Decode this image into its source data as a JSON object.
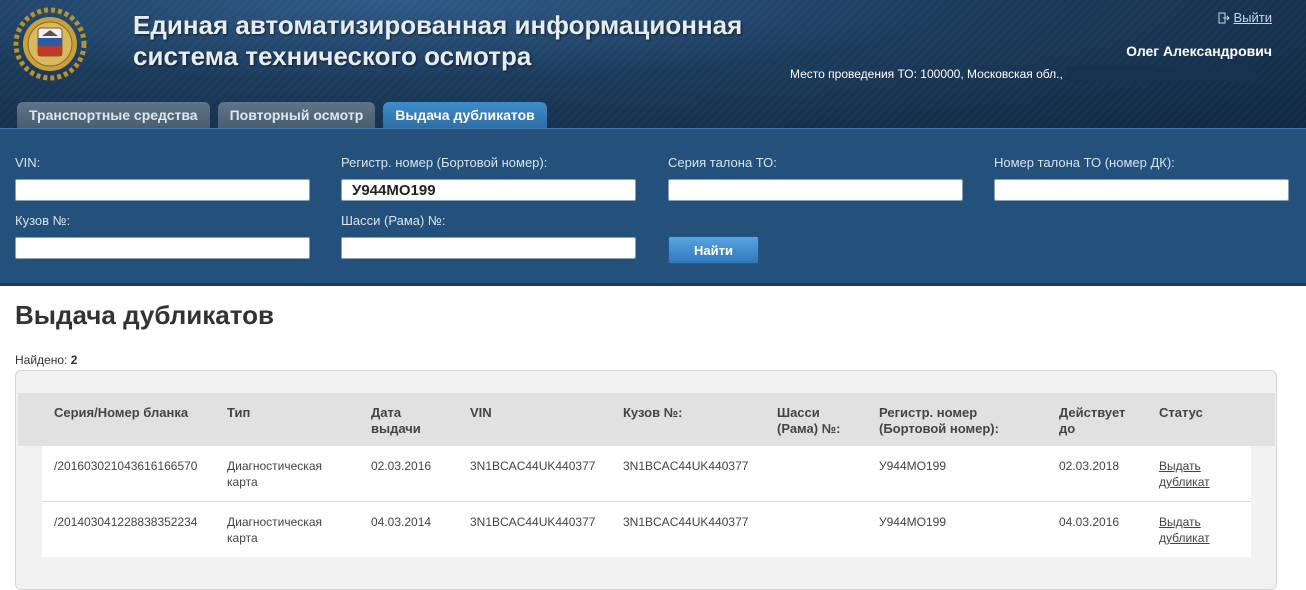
{
  "header": {
    "title_line1": "Единая автоматизированная информационная",
    "title_line2": "система технического осмотра",
    "logout_label": "Выйти",
    "user_name": "Олег Александрович",
    "place_text": "Место проведения ТО: 100000, Московская обл.,",
    "colors": {
      "header_bg": "#1c3b5c",
      "search_bg": "#24507c",
      "active_tab": "#3a86c6"
    }
  },
  "tabs": [
    {
      "label": "Транспортные средства",
      "active": false
    },
    {
      "label": "Повторный осмотр",
      "active": false
    },
    {
      "label": "Выдача дубликатов",
      "active": true
    }
  ],
  "search": {
    "vin_label": "VIN:",
    "vin_value": "",
    "reg_label": "Регистр. номер (Бортовой номер):",
    "reg_value": "У944МО199",
    "series_label": "Серия талона ТО:",
    "series_value": "",
    "ticket_label": "Номер талона ТО (номер ДК):",
    "ticket_value": "",
    "body_label": "Кузов №:",
    "body_value": "",
    "chassis_label": "Шасси (Рама) №:",
    "chassis_value": "",
    "find_label": "Найти"
  },
  "main": {
    "title": "Выдача дубликатов",
    "found_label": "Найдено:",
    "found_count": "2"
  },
  "table": {
    "columns": {
      "series": "Серия/Номер бланка",
      "type": "Тип",
      "date_l1": "Дата",
      "date_l2": "выдачи",
      "vin": "VIN",
      "body": "Кузов №:",
      "chassis_l1": "Шасси",
      "chassis_l2": "(Рама) №:",
      "reg_l1": "Регистр. номер",
      "reg_l2": "(Бортовой номер):",
      "valid_l1": "Действует",
      "valid_l2": "до",
      "status": "Статус"
    },
    "rows": [
      {
        "series": "/201603021043616166570",
        "type_l1": "Диагностическая",
        "type_l2": "карта",
        "date": "02.03.2016",
        "vin": "3N1BCAC44UK440377",
        "body": "3N1BCAC44UK440377",
        "chassis": "",
        "reg": "У944МО199",
        "valid": "02.03.2018",
        "action_l1": "Выдать",
        "action_l2": "дубликат"
      },
      {
        "series": "/201403041228838352234",
        "type_l1": "Диагностическая",
        "type_l2": "карта",
        "date": "04.03.2014",
        "vin": "3N1BCAC44UK440377",
        "body": "3N1BCAC44UK440377",
        "chassis": "",
        "reg": "У944МО199",
        "valid": "04.03.2016",
        "action_l1": "Выдать",
        "action_l2": "дубликат"
      }
    ]
  }
}
